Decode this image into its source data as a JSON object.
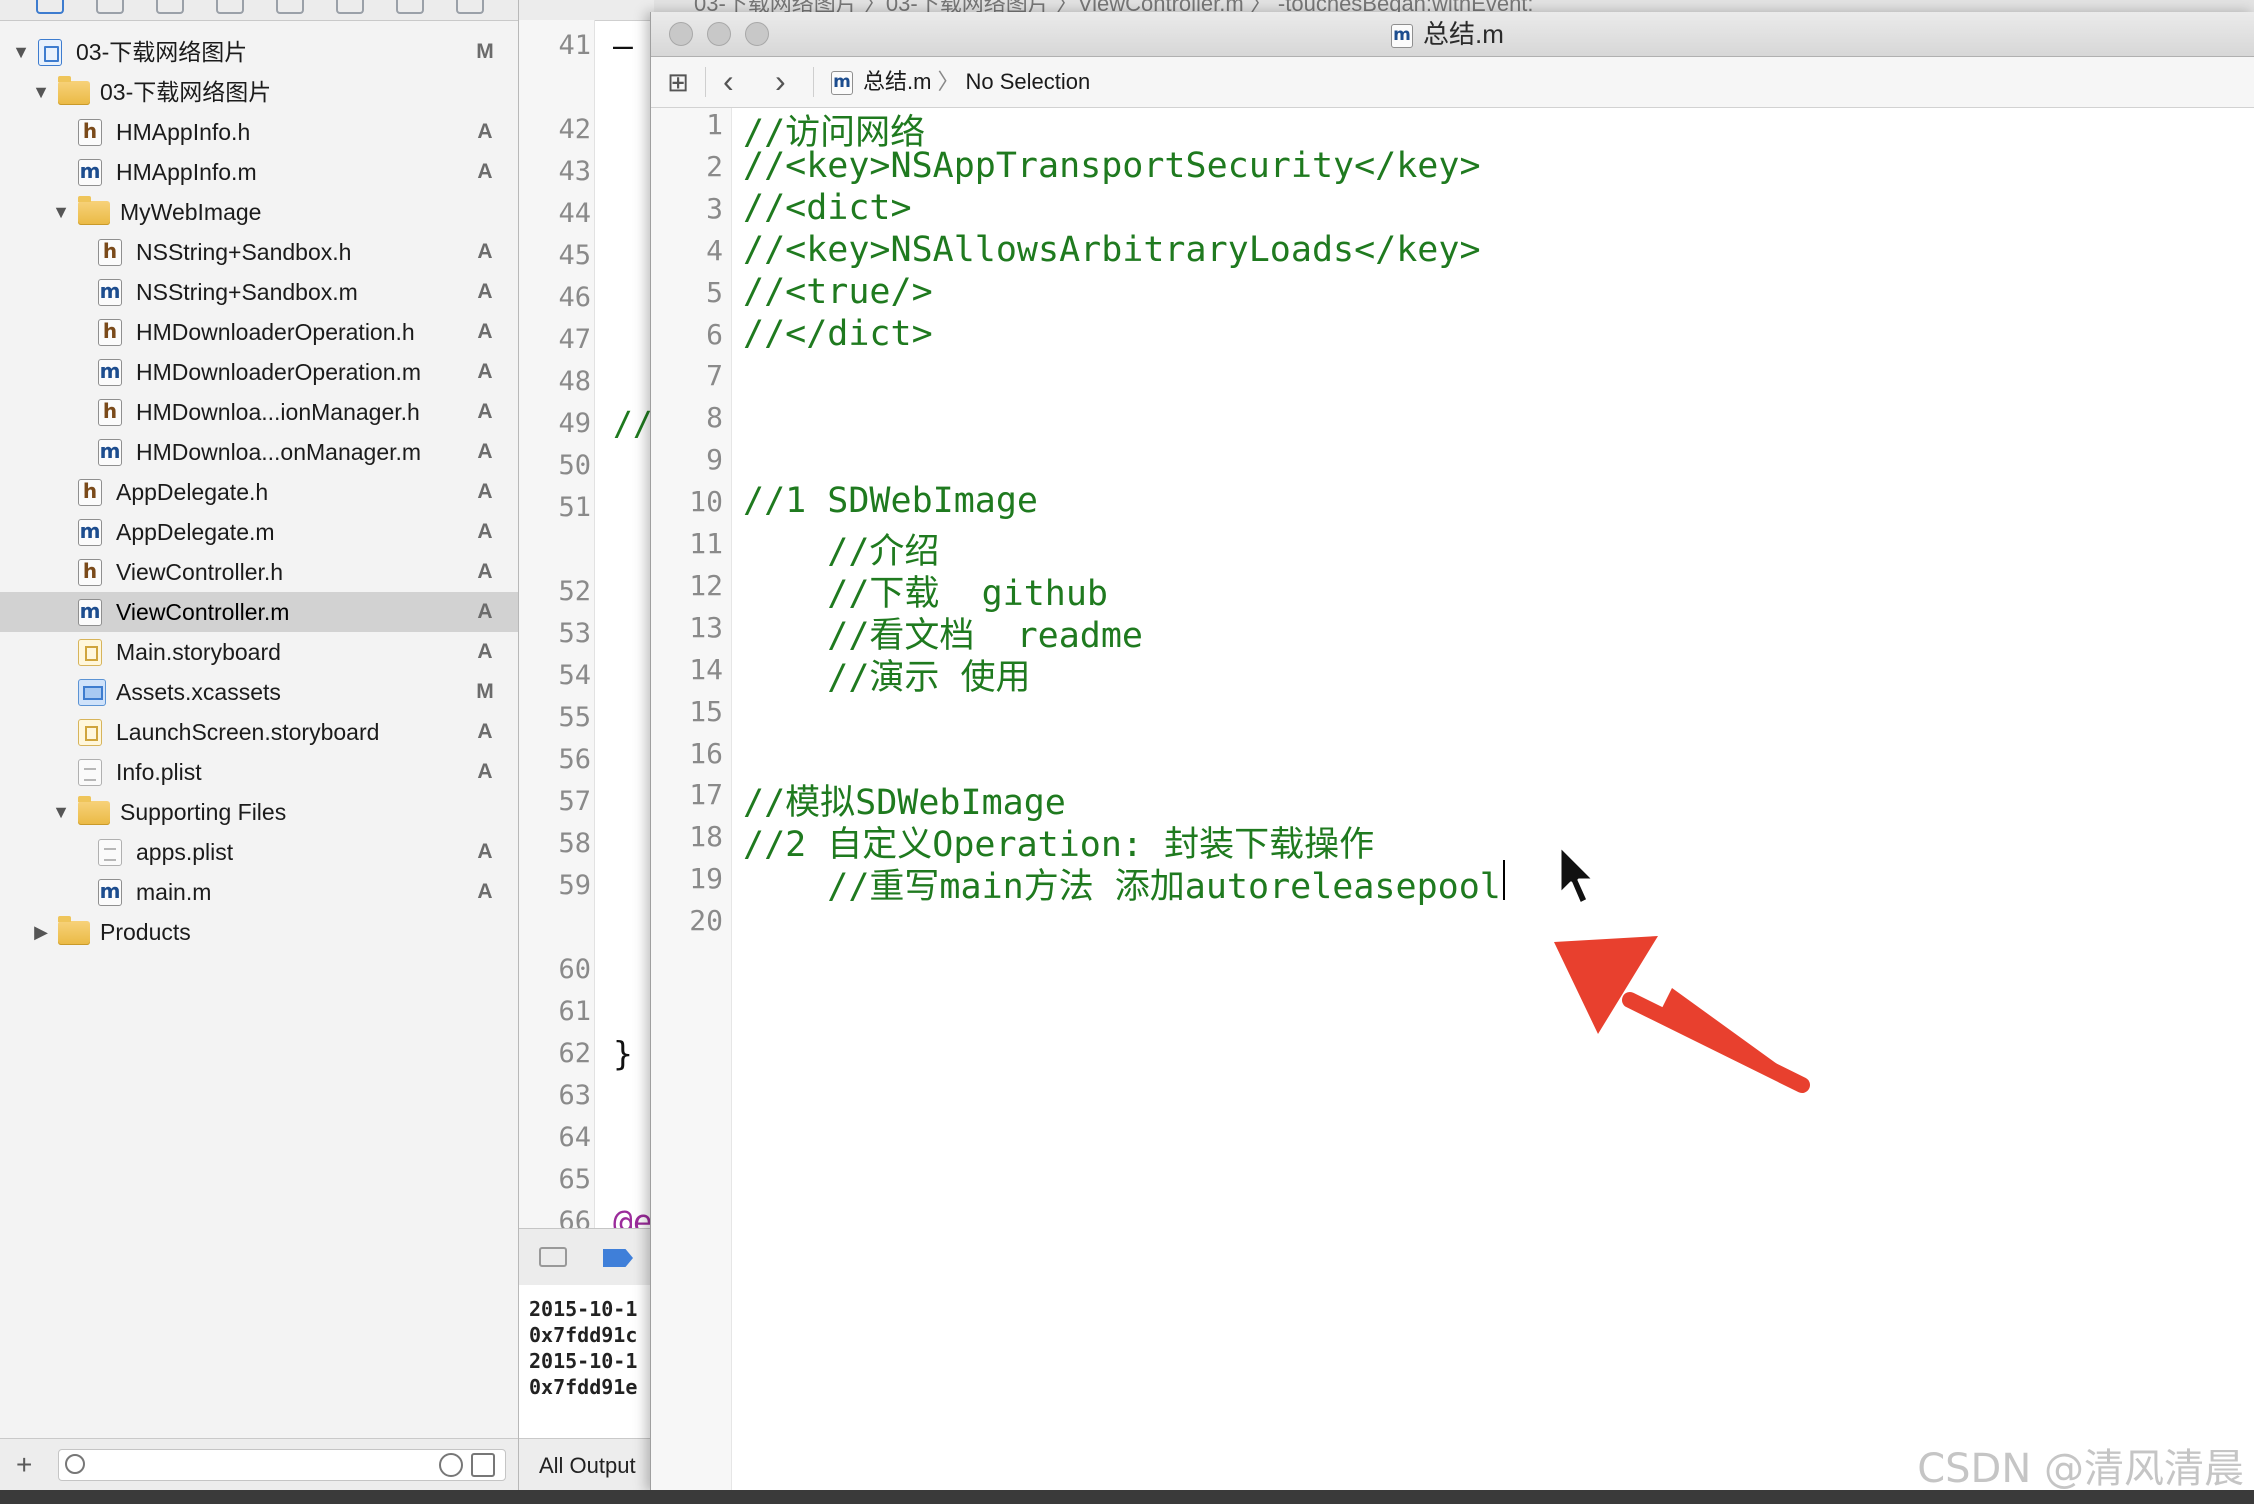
{
  "top_strip": {
    "breadcrumb": "03-下载网络图片 〉03-下载网络图片 〉ViewController.m 〉 -touchesBegan:withEvent:"
  },
  "navigator": {
    "items": [
      {
        "name": "03-下载网络图片",
        "status": "M",
        "icon": "project-icon",
        "depth": 0,
        "disclosure": "▼"
      },
      {
        "name": "03-下载网络图片",
        "status": "",
        "icon": "folder-icon",
        "depth": 1,
        "disclosure": "▼"
      },
      {
        "name": "HMAppInfo.h",
        "status": "A",
        "icon": "header-file-icon",
        "depth": 2,
        "disclosure": ""
      },
      {
        "name": "HMAppInfo.m",
        "status": "A",
        "icon": "source-file-icon",
        "depth": 2,
        "disclosure": ""
      },
      {
        "name": "MyWebImage",
        "status": "",
        "icon": "folder-icon",
        "depth": 2,
        "disclosure": "▼"
      },
      {
        "name": "NSString+Sandbox.h",
        "status": "A",
        "icon": "header-file-icon",
        "depth": 3,
        "disclosure": ""
      },
      {
        "name": "NSString+Sandbox.m",
        "status": "A",
        "icon": "source-file-icon",
        "depth": 3,
        "disclosure": ""
      },
      {
        "name": "HMDownloaderOperation.h",
        "status": "A",
        "icon": "header-file-icon",
        "depth": 3,
        "disclosure": ""
      },
      {
        "name": "HMDownloaderOperation.m",
        "status": "A",
        "icon": "source-file-icon",
        "depth": 3,
        "disclosure": ""
      },
      {
        "name": "HMDownloa...ionManager.h",
        "status": "A",
        "icon": "header-file-icon",
        "depth": 3,
        "disclosure": ""
      },
      {
        "name": "HMDownloa...onManager.m",
        "status": "A",
        "icon": "source-file-icon",
        "depth": 3,
        "disclosure": ""
      },
      {
        "name": "AppDelegate.h",
        "status": "A",
        "icon": "header-file-icon",
        "depth": 2,
        "disclosure": ""
      },
      {
        "name": "AppDelegate.m",
        "status": "A",
        "icon": "source-file-icon",
        "depth": 2,
        "disclosure": ""
      },
      {
        "name": "ViewController.h",
        "status": "A",
        "icon": "header-file-icon",
        "depth": 2,
        "disclosure": ""
      },
      {
        "name": "ViewController.m",
        "status": "A",
        "icon": "source-file-icon",
        "depth": 2,
        "disclosure": "",
        "selected": true
      },
      {
        "name": "Main.storyboard",
        "status": "A",
        "icon": "storyboard-icon",
        "depth": 2,
        "disclosure": ""
      },
      {
        "name": "Assets.xcassets",
        "status": "M",
        "icon": "asset-catalog-icon",
        "depth": 2,
        "disclosure": ""
      },
      {
        "name": "LaunchScreen.storyboard",
        "status": "A",
        "icon": "storyboard-icon",
        "depth": 2,
        "disclosure": ""
      },
      {
        "name": "Info.plist",
        "status": "A",
        "icon": "plist-icon",
        "depth": 2,
        "disclosure": ""
      },
      {
        "name": "Supporting Files",
        "status": "",
        "icon": "folder-icon",
        "depth": 2,
        "disclosure": "▼"
      },
      {
        "name": "apps.plist",
        "status": "A",
        "icon": "plist-icon",
        "depth": 3,
        "disclosure": ""
      },
      {
        "name": "main.m",
        "status": "A",
        "icon": "source-file-icon",
        "depth": 3,
        "disclosure": ""
      },
      {
        "name": "Products",
        "status": "",
        "icon": "folder-icon",
        "depth": 1,
        "disclosure": "▶"
      }
    ],
    "bottom": {
      "add_label": "+"
    }
  },
  "background_editor": {
    "line_numbers": [
      "41",
      "42",
      "43",
      "44",
      "45",
      "46",
      "47",
      "48",
      "49",
      "50",
      "51",
      "52",
      "53",
      "54",
      "55",
      "56",
      "57",
      "58",
      "59",
      "60",
      "61",
      "62",
      "63",
      "64",
      "65",
      "66"
    ],
    "code_fragments": {
      "line41": "—",
      "line49": "//",
      "line62": "}",
      "line66": "@e"
    },
    "console_lines": [
      "2015-10-1",
      "0x7fdd91c",
      "2015-10-1",
      "0x7fdd91e"
    ],
    "console_filter": "All Output"
  },
  "editor": {
    "title": "总结.m",
    "file_icon_letter": "m",
    "jump_path": {
      "file": "总结.m",
      "selection": "No Selection"
    },
    "lines": [
      {
        "n": "1",
        "text": "//访问网络"
      },
      {
        "n": "2",
        "text": "//<key>NSAppTransportSecurity</key>"
      },
      {
        "n": "3",
        "text": "//<dict>"
      },
      {
        "n": "4",
        "text": "//<key>NSAllowsArbitraryLoads</key>"
      },
      {
        "n": "5",
        "text": "//<true/>"
      },
      {
        "n": "6",
        "text": "//</dict>"
      },
      {
        "n": "7",
        "text": ""
      },
      {
        "n": "8",
        "text": ""
      },
      {
        "n": "9",
        "text": ""
      },
      {
        "n": "10",
        "text": "//1 SDWebImage"
      },
      {
        "n": "11",
        "text": "    //介绍"
      },
      {
        "n": "12",
        "text": "    //下载  github"
      },
      {
        "n": "13",
        "text": "    //看文档  readme"
      },
      {
        "n": "14",
        "text": "    //演示 使用"
      },
      {
        "n": "15",
        "text": ""
      },
      {
        "n": "16",
        "text": ""
      },
      {
        "n": "17",
        "text": "//模拟SDWebImage"
      },
      {
        "n": "18",
        "text": "//2 自定义Operation: 封装下载操作"
      },
      {
        "n": "19",
        "text": "    //重写main方法 添加autoreleasepool"
      },
      {
        "n": "20",
        "text": ""
      }
    ],
    "code_color": "#1f7a1f"
  },
  "annotation": {
    "arrow_color": "#e8402e"
  },
  "watermark": "CSDN @清风清晨"
}
